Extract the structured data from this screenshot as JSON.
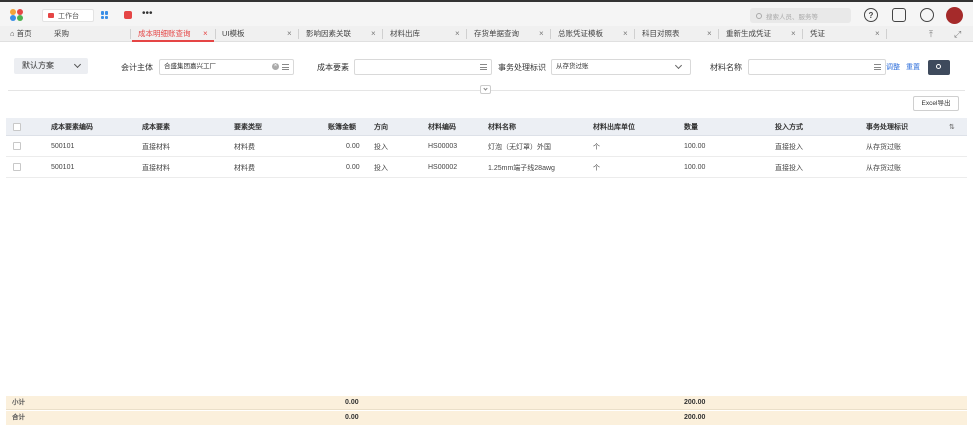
{
  "topbar": {
    "workbench_label": "工作台",
    "more_label": "•••",
    "search_placeholder": "搜索人员、服务等",
    "help_icon": "?"
  },
  "tabs": [
    {
      "label": "首页"
    },
    {
      "label": "采购"
    },
    {
      "label": "成本明细账查询"
    },
    {
      "label": "UI模板"
    },
    {
      "label": "影响因素关联"
    },
    {
      "label": "材料出库"
    },
    {
      "label": "存货单据查询"
    },
    {
      "label": "总账凭证模板"
    },
    {
      "label": "科目对照表"
    },
    {
      "label": "重新生成凭证"
    },
    {
      "label": "凭证"
    }
  ],
  "filters": {
    "scheme": "默认方案",
    "entity_label": "会计主体",
    "entity_value": "合盛集团嘉兴工厂",
    "cost_label": "成本要素",
    "cost_value": "",
    "mark_label": "事务处理标识",
    "mark_value": "从存货过账",
    "material_label": "材料名称",
    "material_value": "",
    "adjust_label": "调整",
    "reset_label": "重置",
    "excel_label": "Excel导出"
  },
  "table": {
    "headers": [
      "成本要素编码",
      "成本要素",
      "要素类型",
      "账簿金额",
      "方向",
      "材料编码",
      "材料名称",
      "材料出库单位",
      "数量",
      "投入方式",
      "事务处理标识"
    ],
    "rows": [
      [
        "500101",
        "直接材料",
        "材料费",
        "0.00",
        "投入",
        "HS00003",
        "灯泡（无灯罩）外国",
        "个",
        "100.00",
        "直接投入",
        "从存货过账"
      ],
      [
        "500101",
        "直接材料",
        "材料费",
        "0.00",
        "投入",
        "HS00002",
        "1.25mm端子线28awg",
        "个",
        "100.00",
        "直接投入",
        "从存货过账"
      ]
    ]
  },
  "totals": {
    "subtotal_label": "小计",
    "subtotal_amount": "0.00",
    "subtotal_qty": "200.00",
    "total_label": "合计",
    "total_amount": "0.00",
    "total_qty": "200.00"
  },
  "colors": {
    "accent": "#e54545",
    "link": "#2f6fdb",
    "search_button": "#3e4a5c",
    "totals_bg": "#fbf0dc"
  }
}
